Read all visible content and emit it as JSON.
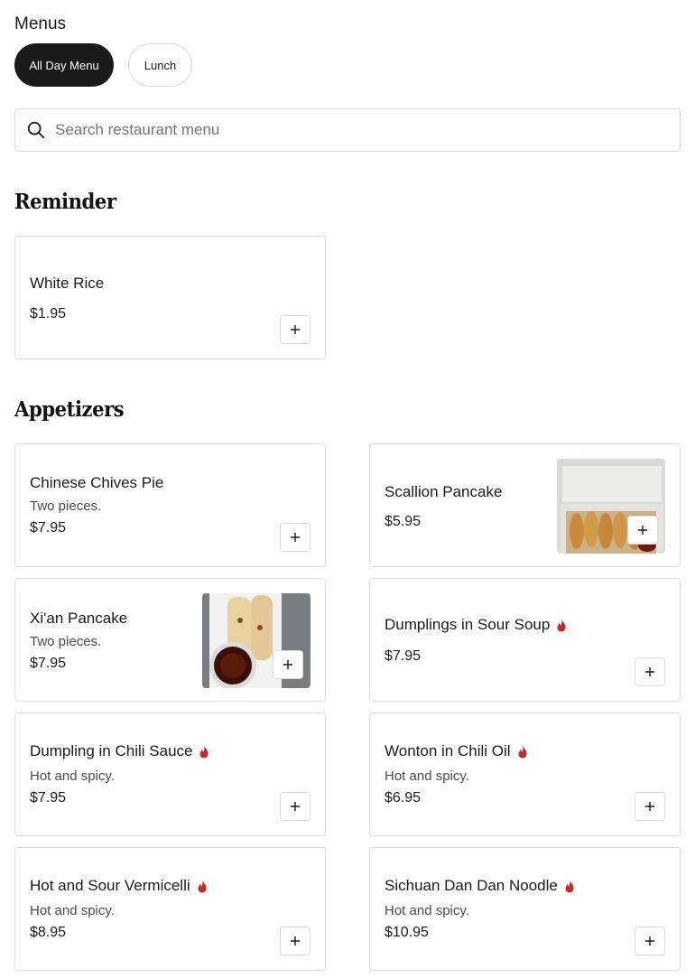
{
  "header": {
    "title": "Menus"
  },
  "tabs": [
    {
      "label": "All Day Menu",
      "active": true
    },
    {
      "label": "Lunch",
      "active": false
    }
  ],
  "search": {
    "placeholder": "Search restaurant menu",
    "value": ""
  },
  "sections": {
    "reminder": {
      "title": "Reminder",
      "items": [
        {
          "name": "White Rice",
          "price": "$1.95"
        }
      ]
    },
    "appetizers": {
      "title": "Appetizers",
      "items": [
        {
          "name": "Chinese Chives Pie",
          "desc": "Two pieces.",
          "price": "$7.95"
        },
        {
          "name": "Scallion Pancake",
          "price": "$5.95",
          "image": "scallion-pancake-photo"
        },
        {
          "name": "Xi'an Pancake",
          "desc": "Two pieces.",
          "price": "$7.95",
          "image": "xian-pancake-photo"
        },
        {
          "name": "Dumplings in Sour Soup",
          "price": "$7.95",
          "spicy": true
        },
        {
          "name": "Dumpling in Chili Sauce",
          "desc": "Hot and spicy.",
          "price": "$7.95",
          "spicy": true
        },
        {
          "name": "Wonton in Chili Oil",
          "desc": "Hot and spicy.",
          "price": "$6.95",
          "spicy": true
        },
        {
          "name": "Hot and Sour Vermicelli",
          "desc": "Hot and spicy.",
          "price": "$8.95",
          "spicy": true
        },
        {
          "name": "Sichuan Dan Dan Noodle",
          "desc": "Hot and spicy.",
          "price": "$10.95",
          "spicy": true
        }
      ]
    }
  },
  "colors": {
    "active_tab": "#1a1a1a",
    "spicy_icon": "#c62828",
    "border": "#e0e0e0"
  }
}
